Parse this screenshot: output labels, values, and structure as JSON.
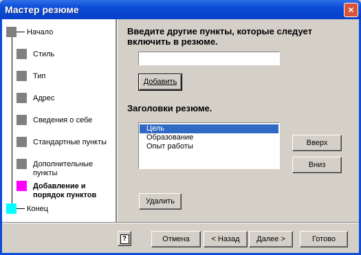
{
  "window": {
    "title": "Мастер резюме",
    "close_symbol": "×"
  },
  "steps": [
    {
      "label": "Начало",
      "color": "#808080"
    },
    {
      "label": "Стиль",
      "color": "#808080"
    },
    {
      "label": "Тип",
      "color": "#808080"
    },
    {
      "label": "Адрес",
      "color": "#808080"
    },
    {
      "label": "Сведения о себе",
      "color": "#808080"
    },
    {
      "label": "Стандартные пункты",
      "color": "#808080"
    },
    {
      "label_line1": "Дополнительные",
      "label_line2": "пункты",
      "color": "#808080"
    },
    {
      "label_line1": "Добавление и",
      "label_line2": "порядок пунктов",
      "color": "#ff00ff",
      "current": true
    },
    {
      "label": "Конец",
      "color": "#00ffff"
    }
  ],
  "main": {
    "add_heading_line1": "Введите другие пункты, которые следует",
    "add_heading_line2": "включить в резюме.",
    "add_input_value": "",
    "add_button": "Добавить",
    "headings_title": "Заголовки резюме.",
    "headings_list": [
      "Цель",
      "Образование",
      "Опыт работы"
    ],
    "selected_index": 0,
    "up_button": "Вверх",
    "down_button": "Вниз",
    "delete_button": "Удалить"
  },
  "footer": {
    "help_symbol": "?",
    "cancel_button": "Отмена",
    "back_button": "< Назад",
    "next_button": "Далее >",
    "finish_button": "Готово"
  }
}
